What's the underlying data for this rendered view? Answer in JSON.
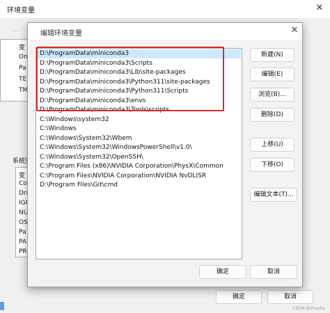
{
  "outer_window": {
    "title": "环境变量",
    "close_glyph": "✕",
    "user_vars_label": "…",
    "user_vars_prefixes": [
      "变",
      "On",
      "Pa",
      "TE",
      "TM"
    ],
    "system_vars_label": "系统变",
    "system_vars_prefixes": [
      "变",
      "Co",
      "Dri",
      "IGC",
      "NU",
      "OS",
      "Pa",
      "PA",
      "PR"
    ],
    "ok_label": "确定",
    "cancel_label": "取消"
  },
  "dialog": {
    "title": "编辑环境变量",
    "close_glyph": "✕",
    "paths": [
      "D:\\ProgramData\\miniconda3",
      "D:\\ProgramData\\miniconda3\\Scripts",
      "D:\\ProgramData\\miniconda3\\Lib\\site-packages",
      "D:\\ProgramData\\miniconda3\\Python311\\site-packages",
      "D:\\ProgramData\\miniconda3\\Python311\\Scripts",
      "D:\\ProgramData\\miniconda3\\envs",
      "D:\\ProgramData\\miniconda3\\Tools\\scripts",
      "C:\\Windows\\system32",
      "C:\\Windows",
      "C:\\Windows\\System32\\Wbem",
      "C:\\Windows\\System32\\WindowsPowerShell\\v1.0\\",
      "C:\\Windows\\System32\\OpenSSH\\",
      "C:\\Program Files (x86)\\NVIDIA Corporation\\PhysX\\Common",
      "C:\\Program Files\\NVIDIA Corporation\\NVIDIA NvDLISR",
      "D:\\Program Files\\Git\\cmd"
    ],
    "buttons": {
      "new": "新建(N)",
      "edit": "编辑(E)",
      "browse": "浏览(B)...",
      "delete": "删除(D)",
      "move_up": "上移(U)",
      "move_down": "下移(O)",
      "edit_text": "编辑文本(T)..."
    },
    "ok_label": "确定",
    "cancel_label": "取消"
  },
  "watermark": "CSDN @zhuoha",
  "colors": {
    "selection": "#cce8ff",
    "highlight_border": "#e0262a"
  }
}
